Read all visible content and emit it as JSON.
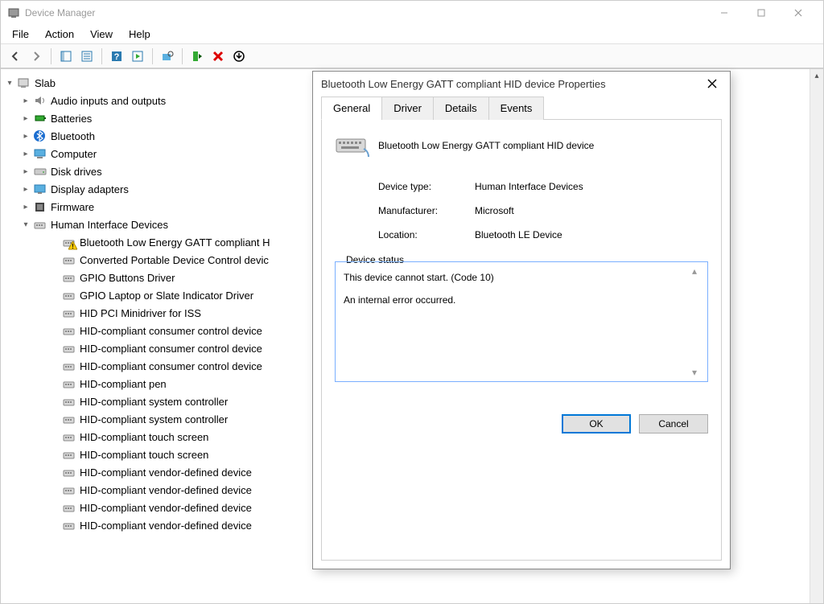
{
  "window": {
    "title": "Device Manager"
  },
  "menubar": [
    "File",
    "Action",
    "View",
    "Help"
  ],
  "tree": {
    "root": "Slab",
    "categories": [
      {
        "label": "Audio inputs and outputs",
        "icon": "audio",
        "expanded": false
      },
      {
        "label": "Batteries",
        "icon": "battery",
        "expanded": false
      },
      {
        "label": "Bluetooth",
        "icon": "bluetooth",
        "expanded": false
      },
      {
        "label": "Computer",
        "icon": "computer",
        "expanded": false
      },
      {
        "label": "Disk drives",
        "icon": "disk",
        "expanded": false
      },
      {
        "label": "Display adapters",
        "icon": "display",
        "expanded": false
      },
      {
        "label": "Firmware",
        "icon": "firmware",
        "expanded": false
      },
      {
        "label": "Human Interface Devices",
        "icon": "hid",
        "expanded": true,
        "children": [
          {
            "label": "Bluetooth Low Energy GATT compliant H",
            "warn": true
          },
          {
            "label": "Converted Portable Device Control devic"
          },
          {
            "label": "GPIO Buttons Driver"
          },
          {
            "label": "GPIO Laptop or Slate Indicator Driver"
          },
          {
            "label": "HID PCI Minidriver for ISS"
          },
          {
            "label": "HID-compliant consumer control device"
          },
          {
            "label": "HID-compliant consumer control device"
          },
          {
            "label": "HID-compliant consumer control device"
          },
          {
            "label": "HID-compliant pen"
          },
          {
            "label": "HID-compliant system controller"
          },
          {
            "label": "HID-compliant system controller"
          },
          {
            "label": "HID-compliant touch screen"
          },
          {
            "label": "HID-compliant touch screen"
          },
          {
            "label": "HID-compliant vendor-defined device"
          },
          {
            "label": "HID-compliant vendor-defined device"
          },
          {
            "label": "HID-compliant vendor-defined device"
          },
          {
            "label": "HID-compliant vendor-defined device"
          }
        ]
      }
    ]
  },
  "dialog": {
    "title": "Bluetooth Low Energy GATT compliant HID device Properties",
    "tabs": [
      "General",
      "Driver",
      "Details",
      "Events"
    ],
    "active_tab": "General",
    "device_name": "Bluetooth Low Energy GATT compliant HID device",
    "rows": {
      "device_type_label": "Device type:",
      "device_type_value": "Human Interface Devices",
      "manufacturer_label": "Manufacturer:",
      "manufacturer_value": "Microsoft",
      "location_label": "Location:",
      "location_value": "Bluetooth LE Device"
    },
    "status_legend": "Device status",
    "status_text_1": "This device cannot start. (Code 10)",
    "status_text_2": "An internal error occurred.",
    "buttons": {
      "ok": "OK",
      "cancel": "Cancel"
    }
  }
}
